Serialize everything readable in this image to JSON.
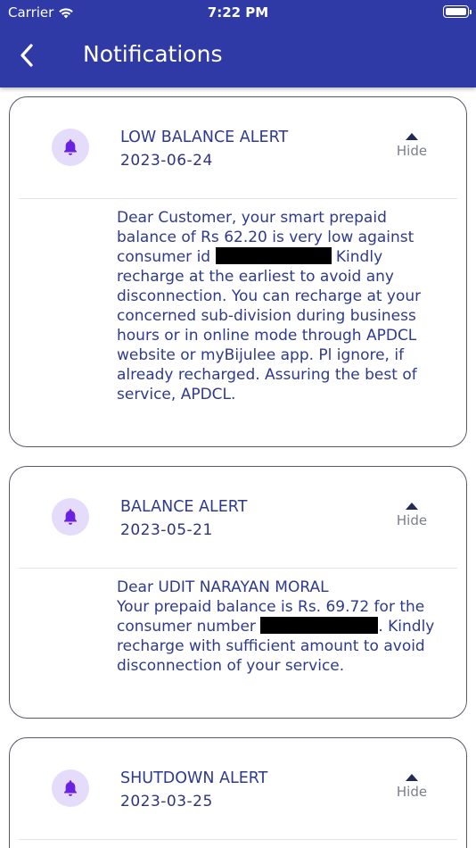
{
  "status_bar": {
    "carrier": "Carrier",
    "time": "7:22 PM"
  },
  "header": {
    "title": "Notifications"
  },
  "notifications": [
    {
      "title": "LOW BALANCE ALERT",
      "date": "2023-06-24",
      "toggle": "Hide",
      "message_a": "Dear Customer, your smart prepaid balance of Rs 62.20 is very low against consumer id",
      "message_b": " Kindly recharge at the earliest to avoid any disconnection. You can recharge at your concerned sub-division during business hours or in online mode through APDCL website or myBijulee app. Pl ignore, if already recharged. Assuring the best of service, APDCL."
    },
    {
      "title": "BALANCE ALERT",
      "date": "2023-05-21",
      "toggle": "Hide",
      "message_line1": "Dear UDIT NARAYAN MORAL",
      "message_a": "Your prepaid balance is Rs. 69.72 for the consumer number",
      "message_b": ". Kindly recharge with sufficient amount to avoid disconnection of your service."
    },
    {
      "title": "SHUTDOWN ALERT",
      "date": "2023-03-25",
      "toggle": "Hide"
    }
  ],
  "colors": {
    "header": "#2f3aa6",
    "text": "#2f3a8f",
    "bell": "#6a22e0",
    "bell_bg": "#e5dcfb"
  },
  "icons": [
    "back-chevron-icon",
    "wifi-icon",
    "battery-icon",
    "bell-icon",
    "caret-up-icon"
  ]
}
